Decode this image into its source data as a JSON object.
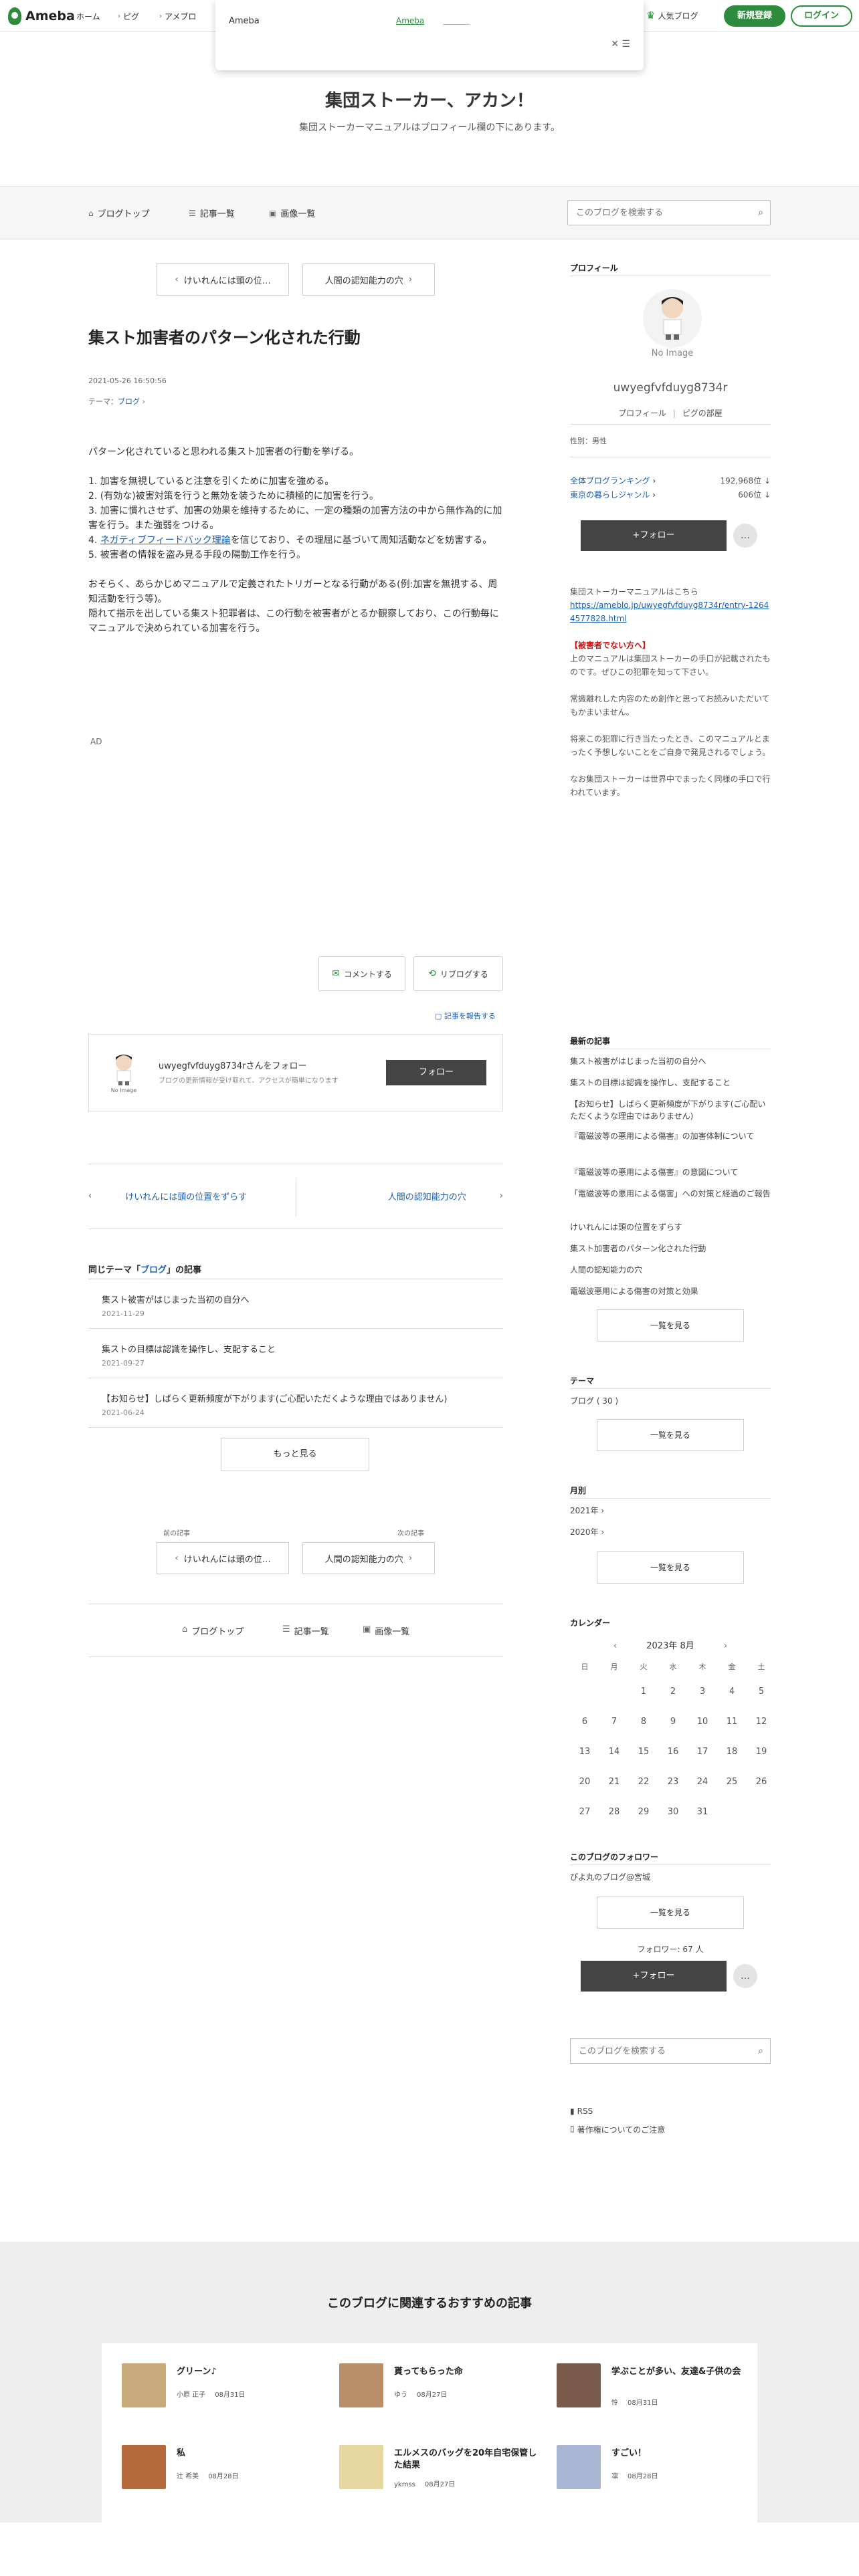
{
  "topbar": {
    "logo": "Ameba",
    "nav": [
      "ホーム",
      "ピグ",
      "アメブロ"
    ],
    "popular": "人気ブログ",
    "signup": "新規登録",
    "login": "ログイン"
  },
  "popup": {
    "title": "Ameba",
    "link": "Ameba",
    "close": "✕"
  },
  "blog": {
    "title": "集団ストーカー、アカン！",
    "description": "集団ストーカーマニュアルはプロフィール欄の下にあります。"
  },
  "subnav": {
    "items": [
      "ブログトップ",
      "記事一覧",
      "画像一覧"
    ],
    "search_placeholder": "このブログを検索する"
  },
  "entry": {
    "prev_label": "けいれんには頭の位…",
    "next_label": "人間の認知能力の穴",
    "title": "集スト加害者のパターン化された行動",
    "date": "2021-05-26 16:50:56",
    "theme_prefix": "テーマ：",
    "theme": "ブログ",
    "para1": "パターン化されていると思われる集スト加害者の行動を挙げる。",
    "list": [
      "1. 加害を無視していると注意を引くために加害を強める。",
      "2. (有効な)被害対策を行うと無効を装うために積極的に加害を行う。",
      "3. 加害に慣れさせず、加害の効果を維持するために、一定の種類の加害方法の中から無作為的に加害を行う。また強弱をつける。",
      "4. ",
      "5. 被害者の情報を盗み見る手段の陽動工作を行う。"
    ],
    "list4_link": "ネガティブフィードバック理論",
    "list4_rest": "を信じており、その理屈に基づいて周知活動などを妨害する。",
    "para3": "おそらく、あらかじめマニュアルで定義されたトリガーとなる行動がある(例:加害を無視する、周知活動を行う等)。",
    "para4": "隠れて指示を出している集スト犯罪者は、この行動を被害者がとるか観察しており、この行動毎にマニュアルで決められている加害を行う。",
    "ad": "AD",
    "comment_btn": "コメントする",
    "reblog_btn": "リブログする",
    "report": "記事を報告する"
  },
  "follow_card": {
    "avatar_text": "No Image",
    "name": "uwyegfvfduyg8734rさんをフォロー",
    "sub": "ブログの更新情報が受け取れて、アクセスが簡単になります",
    "button": "フォロー"
  },
  "pager": {
    "prev": "けいれんには頭の位置をずらす",
    "next": "人間の認知能力の穴"
  },
  "same_theme": {
    "prefix": "同じテーマ「",
    "theme": "ブログ",
    "suffix": "」の記事",
    "items": [
      {
        "title": "集スト被害がはじまった当初の自分へ",
        "date": "2021-11-29"
      },
      {
        "title": "集ストの目標は認識を操作し、支配すること",
        "date": "2021-09-27"
      },
      {
        "title": "【お知らせ】しばらく更新頻度が下がります(ご心配いただくような理由ではありません)",
        "date": "2021-06-24"
      }
    ],
    "more": "もっと見る"
  },
  "prevnext": {
    "prev_label": "前の記事",
    "next_label": "次の記事",
    "prev_title": "けいれんには頭の位…",
    "next_title": "人間の認知能力の穴"
  },
  "bottom_nav": [
    "ブログトップ",
    "記事一覧",
    "画像一覧"
  ],
  "sidebar": {
    "profile_heading": "プロフィール",
    "avatar_text": "No Image",
    "name": "uwyegfvfduyg8734r",
    "profile_link": "プロフィール",
    "pig_link": "ピグの部屋",
    "gender": "性別：男性",
    "ranking1_label": "全体ブログランキング",
    "ranking1_value": "192,968位",
    "ranking2_label": "東京の暮らしジャンル",
    "ranking2_value": "606位",
    "follow": "+フォロー",
    "more": "…",
    "intro": "集団ストーカーマニュアルはこちら",
    "intro_url": "https://ameblo.jp/uwyegfvfduyg8734r/entry-12644577828.html",
    "warning_head": "【被害者でない方へ】",
    "warning_body": "上のマニュアルは集団ストーカーの手口が記載されたものです。ぜひこの犯罪を知って下さい。",
    "text2": "常識離れした内容のため創作と思ってお読みいただいてもかまいません。",
    "text3": "将来この犯罪に行き当たったとき、このマニュアルとまったく予想しないことをご自身で発見されるでしょう。",
    "text4": "なお集団ストーカーは世界中でまったく同様の手口で行われています。",
    "recent_heading": "最新の記事",
    "recent": [
      "集スト被害がはじまった当初の自分へ",
      "集ストの目標は認識を操作し、支配すること",
      "【お知らせ】しばらく更新頻度が下がります(ご心配いただくような理由ではありません)",
      "『電磁波等の悪用による傷害』の加害体制について",
      "『電磁波等の悪用による傷害』の意図について",
      "「電磁波等の悪用による傷害」への対策と経過のご報告",
      "けいれんには頭の位置をずらす",
      "集スト加害者のパターン化された行動",
      "人間の認知能力の穴",
      "電磁波悪用による傷害の対策と効果"
    ],
    "see_all": "一覧を見る",
    "theme_heading": "テーマ",
    "theme_item": "ブログ ( 30 )",
    "monthly_heading": "月別",
    "years": [
      "2021年",
      "2020年"
    ],
    "calendar_heading": "カレンダー",
    "calendar_month": "2023年 8月",
    "dow": [
      "日",
      "月",
      "火",
      "水",
      "木",
      "金",
      "土"
    ],
    "weeks": [
      [
        "",
        "",
        "1",
        "2",
        "3",
        "4",
        "5"
      ],
      [
        "6",
        "7",
        "8",
        "9",
        "10",
        "11",
        "12"
      ],
      [
        "13",
        "14",
        "15",
        "16",
        "17",
        "18",
        "19"
      ],
      [
        "20",
        "21",
        "22",
        "23",
        "24",
        "25",
        "26"
      ],
      [
        "27",
        "28",
        "29",
        "30",
        "31",
        "",
        ""
      ]
    ],
    "followers_heading": "このブログのフォロワー",
    "follower_item": "ぴよ丸のブログ@宮城",
    "followers_count": "フォロワー: 67 人",
    "search_placeholder": "このブログを検索する",
    "rss": "RSS",
    "copyright": "著作権についてのご注意"
  },
  "recommended": {
    "title": "このブログに関連するおすすめの記事",
    "items": [
      {
        "title": "グリーン♪",
        "author": "小原 正子",
        "date": "08月31日",
        "color": "#c7a97a"
      },
      {
        "title": "貰ってもらった命",
        "author": "ゆう",
        "date": "08月27日",
        "color": "#b88d68"
      },
      {
        "title": "学ぶことが多い、友達&子供の会",
        "author": "怜",
        "date": "08月31日",
        "color": "#7a5a4a"
      },
      {
        "title": "私",
        "author": "辻 希美",
        "date": "08月28日",
        "color": "#b56a3e"
      },
      {
        "title": "エルメスのバッグを20年自宅保管した結果",
        "author": "ykmss",
        "date": "08月27日",
        "color": "#e6d7a0"
      },
      {
        "title": "すごい！",
        "author": "凛",
        "date": "08月28日",
        "color": "#a9b7d4"
      }
    ]
  }
}
